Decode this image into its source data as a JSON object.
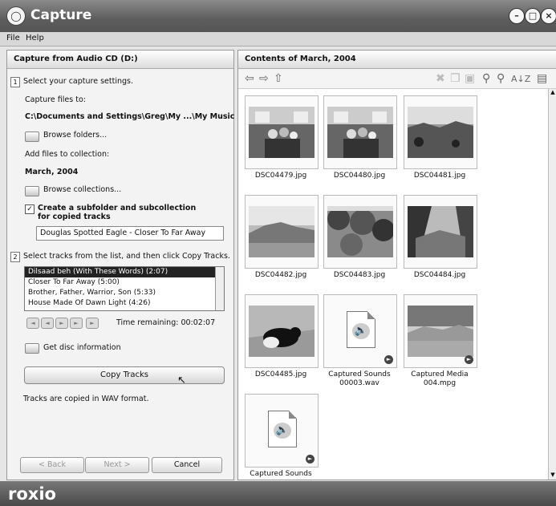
{
  "window": {
    "title": "Capture"
  },
  "menu": [
    "File",
    "Help"
  ],
  "left": {
    "header": "Capture from Audio CD (D:)",
    "step1_num": "1",
    "step1_text": "Select your capture settings.",
    "capture_to_label": "Capture files to:",
    "capture_to_path": "C:\\Documents and Settings\\Greg\\My ...\\My Music",
    "browse_folders": "Browse folders...",
    "add_to_collection_label": "Add files to collection:",
    "collection_name": "March, 2004",
    "browse_collections": "Browse collections...",
    "create_subfolder_label": "Create a subfolder and subcollection for copied tracks",
    "subfolder_name": "Douglas Spotted Eagle - Closer To Far Away",
    "step2_num": "2",
    "step2_text": "Select tracks from the list, and then click Copy Tracks.",
    "tracks": [
      "Dilsaad beh (With These Words) (2:07)",
      "Closer To Far Away (5:00)",
      "Brother, Father, Warrior, Son (5:33)",
      "House Made Of Dawn Light (4:26)"
    ],
    "time_remaining": "Time remaining:  00:02:07",
    "get_disc_info": "Get disc information",
    "copy_tracks": "Copy Tracks",
    "format_note": "Tracks are copied in WAV format.",
    "back": "< Back",
    "next": "Next >",
    "cancel": "Cancel"
  },
  "right": {
    "header": "Contents of March, 2004",
    "items": [
      {
        "caption": "DSC04479.jpg",
        "kind": "photo-group"
      },
      {
        "caption": "DSC04480.jpg",
        "kind": "photo-group"
      },
      {
        "caption": "DSC04481.jpg",
        "kind": "photo-landscape"
      },
      {
        "caption": "DSC04482.jpg",
        "kind": "photo-mountain"
      },
      {
        "caption": "DSC04483.jpg",
        "kind": "photo-trees"
      },
      {
        "caption": "DSC04484.jpg",
        "kind": "photo-valley"
      },
      {
        "caption": "DSC04485.jpg",
        "kind": "photo-dog"
      },
      {
        "caption": "Captured Sounds 00003.wav",
        "kind": "audio"
      },
      {
        "caption": "Captured Media 004.mpg",
        "kind": "photo-mountain-sky"
      },
      {
        "caption": "Captured Sounds",
        "kind": "audio"
      }
    ]
  },
  "brand": "roxio"
}
